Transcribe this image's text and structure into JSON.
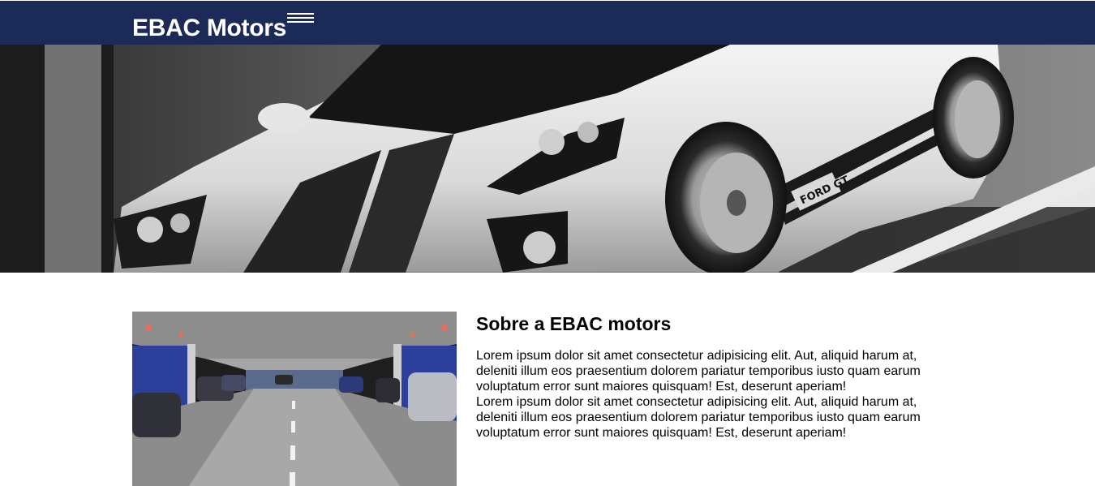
{
  "header": {
    "logo": "EBAC Motors",
    "menu_icon": "hamburger-menu-icon"
  },
  "hero": {
    "image": "sports-car-photo",
    "badge_text": "FORD GT"
  },
  "about": {
    "image": "parking-garage-photo",
    "title": "Sobre a EBAC motors",
    "paragraphs": [
      "Lorem ipsum dolor sit amet consectetur adipisicing elit. Aut, aliquid harum at, deleniti illum eos praesentium dolorem pariatur temporibus iusto quam earum voluptatum error sunt maiores quisquam! Est, deserunt aperiam!",
      "Lorem ipsum dolor sit amet consectetur adipisicing elit. Aut, aliquid harum at, deleniti illum eos praesentium dolorem pariatur temporibus iusto quam earum voluptatum error sunt maiores quisquam! Est, deserunt aperiam!"
    ]
  },
  "colors": {
    "header_bg": "#1b2a57",
    "text": "#000000",
    "garage_wall": "#2c3f9a"
  }
}
